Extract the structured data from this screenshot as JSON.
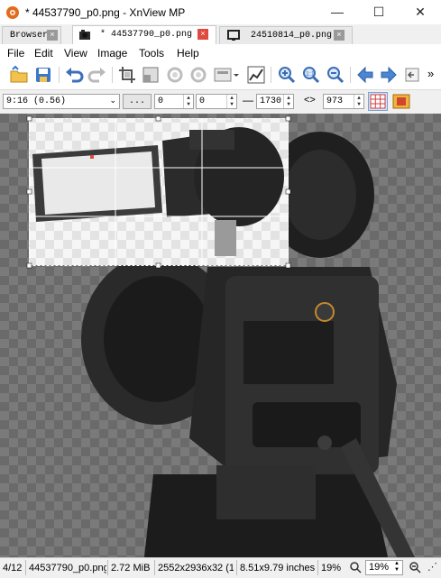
{
  "window": {
    "title": "* 44537790_p0.png - XnView MP",
    "minimize_glyph": "—",
    "maximize_glyph": "☐",
    "close_glyph": "✕"
  },
  "tabs": [
    {
      "label": "Browser",
      "active": false,
      "close_glyph": "×"
    },
    {
      "label": "* 44537790_p0.png",
      "active": true,
      "close_glyph": "×"
    },
    {
      "label": "24510814_p0.png",
      "active": false,
      "close_glyph": "×"
    }
  ],
  "menu": [
    "File",
    "Edit",
    "View",
    "Image",
    "Tools",
    "Help"
  ],
  "toolbar": {
    "icons": [
      "open-folder-icon",
      "save-icon",
      "undo-icon",
      "redo-icon",
      "crop-icon",
      "resize-icon",
      "rotate-left-icon",
      "rotate-right-icon",
      "adjust-icon",
      "histogram-icon",
      "zoom-in-icon",
      "zoom-actual-icon",
      "zoom-out-icon",
      "previous-icon",
      "next-icon",
      "exit-icon"
    ],
    "overflow_glyph": "»"
  },
  "crop": {
    "ratio_value": "9:16 (0.56)",
    "more_label": "...",
    "x_value": "0",
    "y_value": "0",
    "dash": "—",
    "width_value": "1730",
    "swap_glyph": "<>",
    "height_value": "973"
  },
  "status": {
    "index": "4/12",
    "filename": "44537790_p0.png",
    "filesize": "2.72 MiB",
    "dimensions": "2552x2936x32 (1",
    "print_size": "8.51x9.79 inches",
    "zoom": "19%",
    "zoom_select": "19%"
  },
  "colors": {
    "accent_red": "#e0493d",
    "canvas_bg": "#707070",
    "arrow_blue": "#4a86d4"
  }
}
